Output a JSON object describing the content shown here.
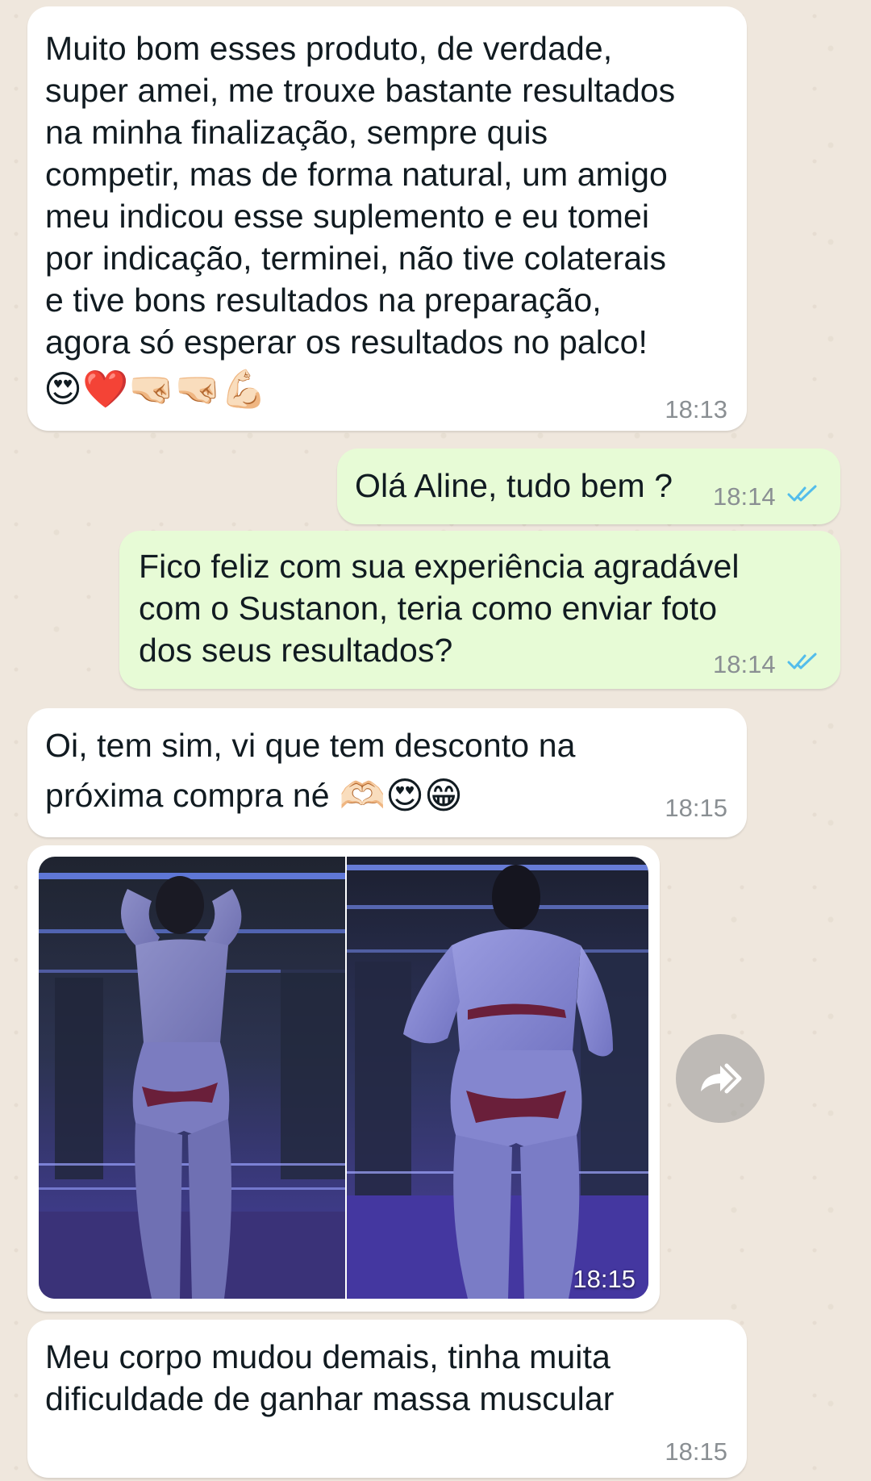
{
  "chat": {
    "messages": [
      {
        "direction": "incoming",
        "text": "Muito bom esses produto, de verdade,\nsuper amei, me trouxe bastante resultados\nna minha finalização, sempre quis\ncompetir, mas de forma natural, um amigo\nmeu indicou esse suplemento e eu tomei\npor indicação, terminei, não tive colaterais\ne tive bons resultados na preparação,\nagora só esperar os resultados no palco!",
        "emojis": "😍❤️🤜🏻🤜🏻💪🏻",
        "time": "18:13"
      },
      {
        "direction": "outgoing",
        "text": "Olá Aline, tudo bem ?",
        "time": "18:14",
        "status": "read"
      },
      {
        "direction": "outgoing",
        "text": "Fico feliz com sua experiência agradável\ncom o Sustanon, teria como enviar foto\ndos seus resultados?",
        "time": "18:14",
        "status": "read"
      },
      {
        "direction": "incoming",
        "text_line1": "Oi, tem sim, vi que tem desconto na",
        "text_line2": "próxima compra né",
        "emojis": "🫶🏻😍😁",
        "time": "18:15"
      },
      {
        "direction": "incoming",
        "type": "image",
        "time": "18:15",
        "forward_icon": "forward-icon"
      },
      {
        "direction": "incoming",
        "text": "Meu corpo mudou demais, tinha muita\ndificuldade de ganhar massa muscular",
        "time": "18:15"
      }
    ]
  },
  "colors": {
    "incoming_bubble": "#ffffff",
    "outgoing_bubble": "#e7fbd6",
    "read_ticks": "#53bdeb",
    "timestamp": "#8a8f93"
  }
}
